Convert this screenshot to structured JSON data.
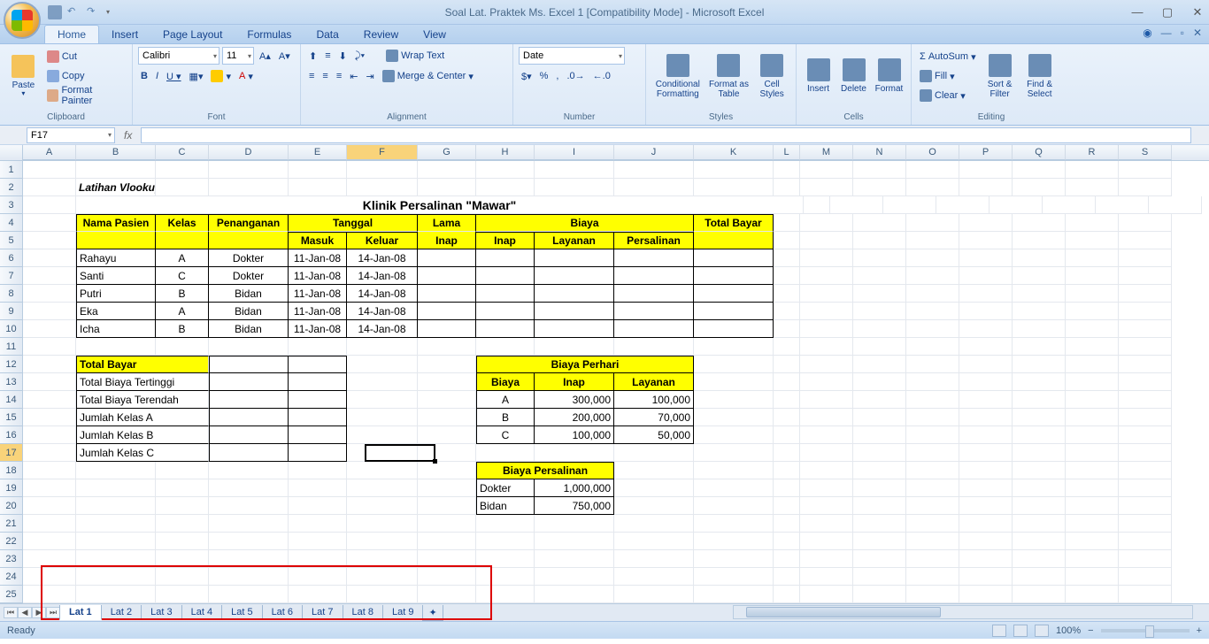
{
  "app": {
    "title": "Soal Lat. Praktek Ms. Excel 1  [Compatibility Mode] - Microsoft Excel",
    "status_ready": "Ready",
    "zoom": "100%"
  },
  "ribbon_tabs": [
    "Home",
    "Insert",
    "Page Layout",
    "Formulas",
    "Data",
    "Review",
    "View"
  ],
  "clipboard": {
    "paste": "Paste",
    "cut": "Cut",
    "copy": "Copy",
    "painter": "Format Painter",
    "label": "Clipboard"
  },
  "font": {
    "name": "Calibri",
    "size": "11",
    "label": "Font"
  },
  "alignment": {
    "wrap": "Wrap Text",
    "merge": "Merge & Center",
    "label": "Alignment"
  },
  "number": {
    "format": "Date",
    "label": "Number"
  },
  "styles": {
    "cf": "Conditional Formatting",
    "fat": "Format as Table",
    "cs": "Cell Styles",
    "label": "Styles"
  },
  "cells": {
    "insert": "Insert",
    "delete": "Delete",
    "format": "Format",
    "label": "Cells"
  },
  "editing": {
    "autosum": "AutoSum",
    "fill": "Fill",
    "clear": "Clear",
    "sort": "Sort & Filter",
    "find": "Find & Select",
    "label": "Editing"
  },
  "namebox": "F17",
  "columns": [
    "A",
    "B",
    "C",
    "D",
    "E",
    "F",
    "G",
    "H",
    "I",
    "J",
    "K",
    "L",
    "M",
    "N",
    "O",
    "P",
    "Q",
    "R",
    "S"
  ],
  "sheet": {
    "title_ital": "Latihan Vlookup,Count If & If",
    "klinik_title": "Klinik Persalinan \"Mawar\"",
    "hdr": {
      "nama": "Nama Pasien",
      "kelas": "Kelas",
      "penanganan": "Penanganan",
      "tanggal": "Tanggal",
      "masuk": "Masuk",
      "keluar": "Keluar",
      "lama": "Lama",
      "inap": "Inap",
      "biaya": "Biaya",
      "b_inap": "Inap",
      "b_layanan": "Layanan",
      "b_persalinan": "Persalinan",
      "total": "Total Bayar"
    },
    "rows": [
      {
        "nama": "Rahayu",
        "kelas": "A",
        "pen": "Dokter",
        "masuk": "11-Jan-08",
        "keluar": "14-Jan-08"
      },
      {
        "nama": "Santi",
        "kelas": "C",
        "pen": "Dokter",
        "masuk": "11-Jan-08",
        "keluar": "14-Jan-08"
      },
      {
        "nama": "Putri",
        "kelas": "B",
        "pen": "Bidan",
        "masuk": "11-Jan-08",
        "keluar": "14-Jan-08"
      },
      {
        "nama": "Eka",
        "kelas": "A",
        "pen": "Bidan",
        "masuk": "11-Jan-08",
        "keluar": "14-Jan-08"
      },
      {
        "nama": "Icha",
        "kelas": "B",
        "pen": "Bidan",
        "masuk": "11-Jan-08",
        "keluar": "14-Jan-08"
      }
    ],
    "summary": {
      "total_bayar": "Total Bayar",
      "tertinggi": "Total Biaya Tertinggi",
      "terendah": "Total Biaya Terendah",
      "jka": "Jumlah Kelas A",
      "jkb": "Jumlah Kelas B",
      "jkc": "Jumlah Kelas C"
    },
    "perhari": {
      "title": "Biaya Perhari",
      "h_biaya": "Biaya",
      "h_inap": "Inap",
      "h_layanan": "Layanan",
      "rows": [
        {
          "k": "A",
          "inap": "300,000",
          "lay": "100,000"
        },
        {
          "k": "B",
          "inap": "200,000",
          "lay": "70,000"
        },
        {
          "k": "C",
          "inap": "100,000",
          "lay": "50,000"
        }
      ]
    },
    "persalinan": {
      "title": "Biaya Persalinan",
      "rows": [
        {
          "k": "Dokter",
          "v": "1,000,000"
        },
        {
          "k": "Bidan",
          "v": "750,000"
        }
      ]
    }
  },
  "sheet_tabs": [
    "Lat 1",
    "Lat 2",
    "Lat 3",
    "Lat 4",
    "Lat 5",
    "Lat 6",
    "Lat 7",
    "Lat 8",
    "Lat 9"
  ]
}
